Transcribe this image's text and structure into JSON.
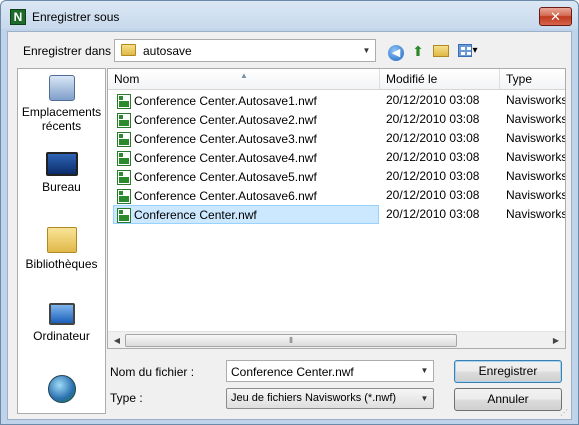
{
  "window": {
    "title": "Enregistrer sous",
    "close_glyph": "✕",
    "app_icon": "N"
  },
  "toolbar": {
    "save_in_label": "Enregistrer dans :",
    "current_folder": "autosave",
    "icons": [
      "back-icon",
      "up-folder-icon",
      "new-folder-icon",
      "view-menu-icon"
    ]
  },
  "places": [
    {
      "label": "Emplacements récents",
      "icon": "recent-places-icon"
    },
    {
      "label": "Bureau",
      "icon": "desktop-icon"
    },
    {
      "label": "Bibliothèques",
      "icon": "libraries-icon"
    },
    {
      "label": "Ordinateur",
      "icon": "computer-icon"
    },
    {
      "label": "",
      "icon": "network-icon"
    }
  ],
  "list": {
    "columns": {
      "name": "Nom",
      "modified": "Modifié le",
      "type": "Type"
    },
    "files": [
      {
        "name": "Conference Center.Autosave1.nwf",
        "modified": "20/12/2010 03:08",
        "type": "Navisworks"
      },
      {
        "name": "Conference Center.Autosave2.nwf",
        "modified": "20/12/2010 03:08",
        "type": "Navisworks"
      },
      {
        "name": "Conference Center.Autosave3.nwf",
        "modified": "20/12/2010 03:08",
        "type": "Navisworks"
      },
      {
        "name": "Conference Center.Autosave4.nwf",
        "modified": "20/12/2010 03:08",
        "type": "Navisworks"
      },
      {
        "name": "Conference Center.Autosave5.nwf",
        "modified": "20/12/2010 03:08",
        "type": "Navisworks"
      },
      {
        "name": "Conference Center.Autosave6.nwf",
        "modified": "20/12/2010 03:08",
        "type": "Navisworks"
      },
      {
        "name": "Conference Center.nwf",
        "modified": "20/12/2010 03:08",
        "type": "Navisworks",
        "selected": true
      }
    ]
  },
  "form": {
    "filename_label": "Nom du fichier :",
    "filename_value": "Conference Center.nwf",
    "type_label": "Type :",
    "type_value": "Jeu de fichiers Navisworks (*.nwf)",
    "save_label": "Enregistrer",
    "cancel_label": "Annuler"
  }
}
